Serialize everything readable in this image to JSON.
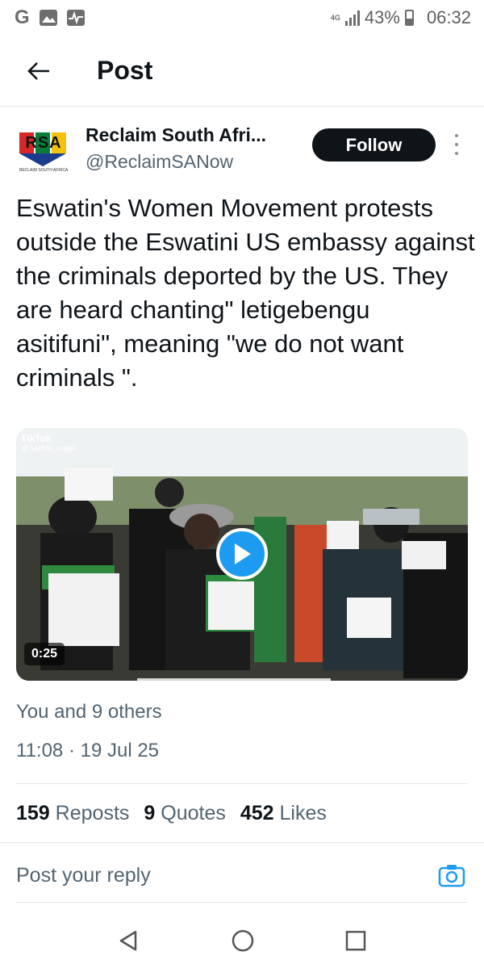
{
  "status_bar": {
    "net": "4G",
    "battery_percent": "43%",
    "time": "06:32",
    "left_icons": [
      "g-icon",
      "gallery-icon",
      "activity-icon"
    ]
  },
  "header": {
    "title": "Post"
  },
  "author": {
    "name": "Reclaim South Afri...",
    "handle": "@ReclaimSANow",
    "follow_label": "Follow",
    "avatar_brand": "RSA",
    "avatar_sub": "RECLAIM SOUTH AFRICA"
  },
  "tweet": {
    "text": "Eswatin's Women Movement protests outside the Eswatini US embassy against the criminals deported by the US. They are heard chanting\" letigebengu asitifuni\", meaning \"we do not want criminals \"."
  },
  "media": {
    "watermark": "TikTok",
    "watermark_handle": "@ sakhile_mega",
    "duration": "0:25"
  },
  "meta": {
    "liked_by": "You and 9 others",
    "timestamp": "11:08 · 19 Jul 25"
  },
  "stats": {
    "reposts_count": "159",
    "reposts_label": "Reposts",
    "quotes_count": "9",
    "quotes_label": "Quotes",
    "likes_count": "452",
    "likes_label": "Likes"
  },
  "reply": {
    "placeholder": "Post your reply"
  },
  "colors": {
    "accent": "#1d9bf0",
    "text": "#0f1419",
    "muted": "#536471"
  }
}
